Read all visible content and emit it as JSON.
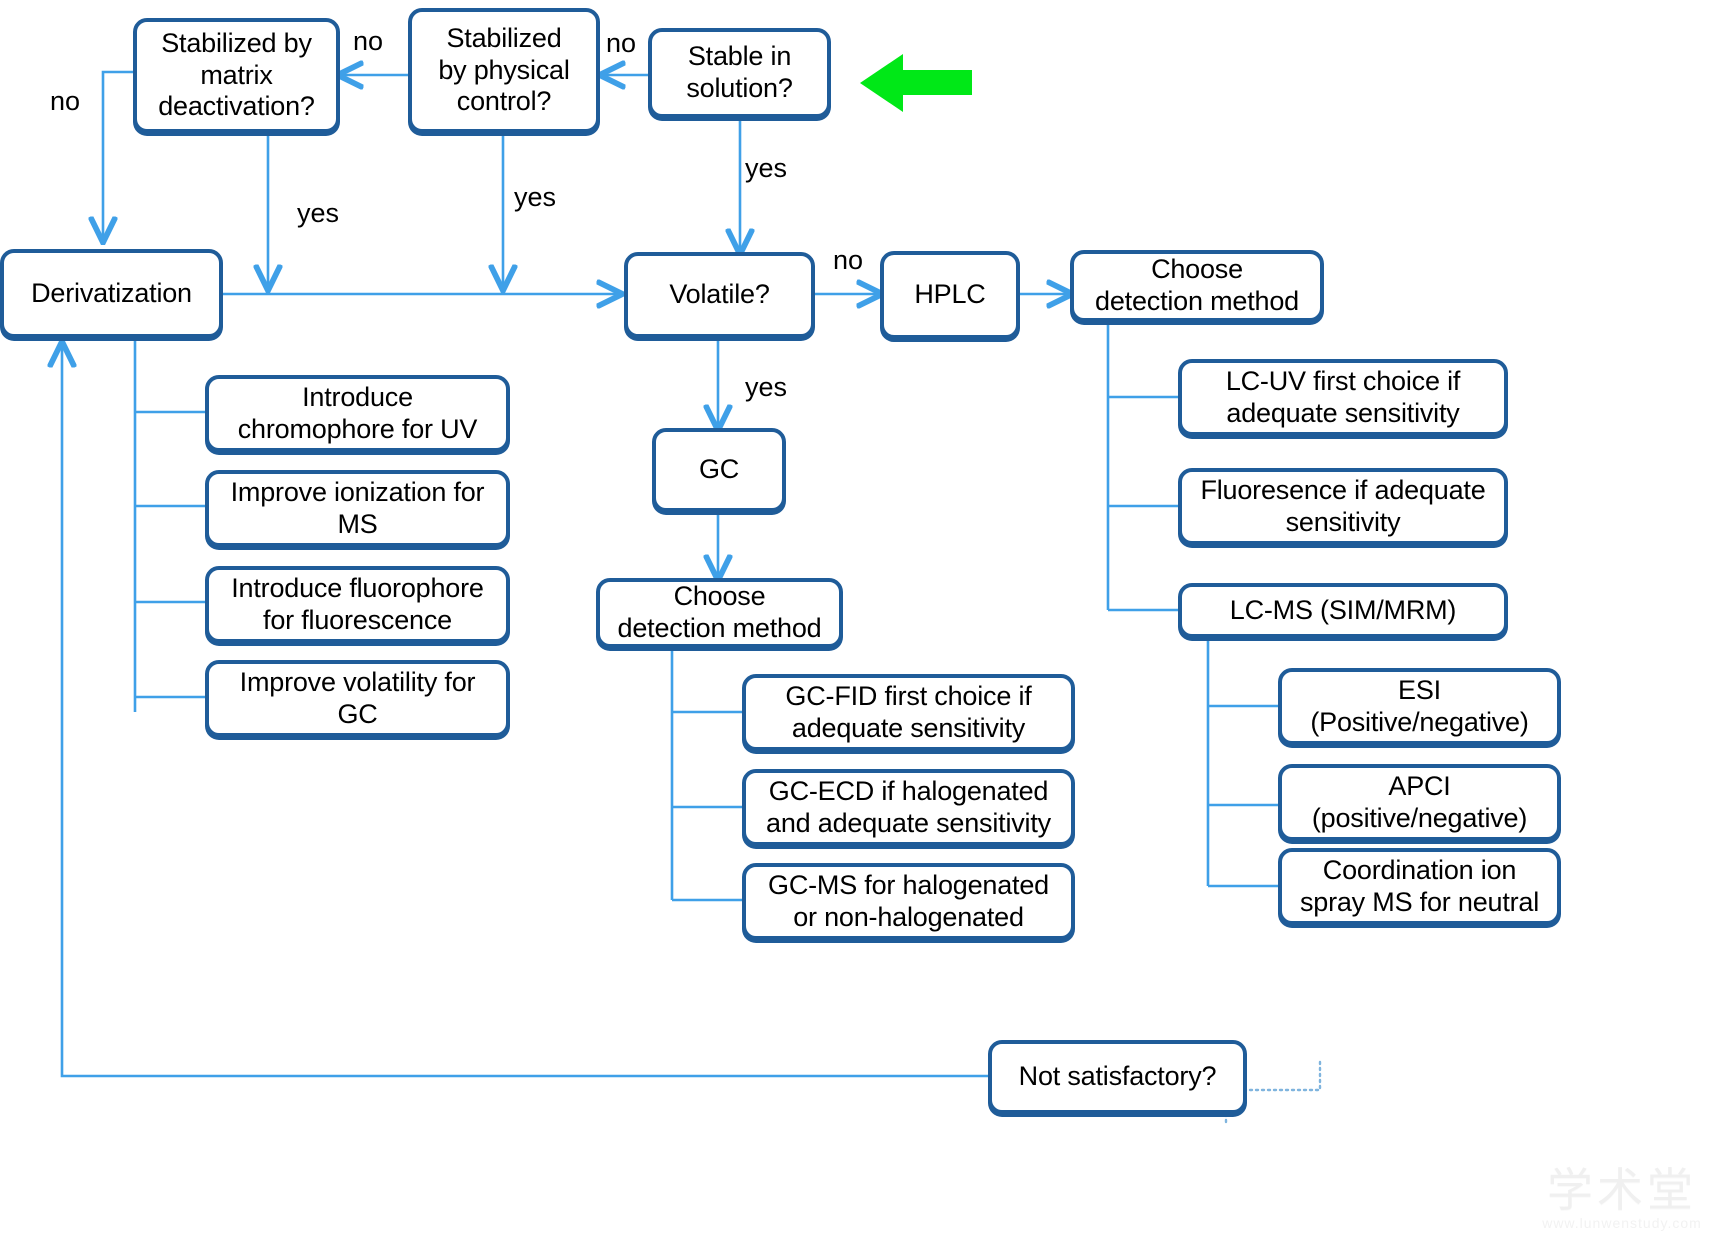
{
  "diagram": {
    "title": "Analytical method selection decision flowchart",
    "colors": {
      "node_border": "#1F5C99",
      "node_fill": "#FFFFFF",
      "connector": "#3FA0E8",
      "pointer_arrow": "#00E817",
      "text": "#000000"
    },
    "nodes": {
      "stabilized_matrix": "Stabilized by\nmatrix\ndeactivation?",
      "stabilized_matrix_lines": [
        "Stabilized by",
        "matrix",
        "deactivation?"
      ],
      "stabilized_physical_lines": [
        "Stabilized",
        "by physical",
        "control?"
      ],
      "stable_solution_lines": [
        "Stable in",
        "solution?"
      ],
      "derivatization_lines": [
        "Derivatization"
      ],
      "volatile_lines": [
        "Volatile?"
      ],
      "hplc_lines": [
        "HPLC"
      ],
      "gc_lines": [
        "GC"
      ],
      "choose_detection_lc_lines": [
        "Choose",
        "detection method"
      ],
      "choose_detection_gc_lines": [
        "Choose",
        "detection method"
      ],
      "not_satisfactory_lines": [
        "Not satisfactory?"
      ],
      "deriv_children": [
        [
          "Introduce",
          "chromophore for UV"
        ],
        [
          "Improve ionization for",
          "MS"
        ],
        [
          "Introduce fluorophore",
          "for  fluorescence"
        ],
        [
          "Improve volatility for",
          "GC"
        ]
      ],
      "gc_detection_children": [
        [
          "GC-FID first choice if",
          "adequate sensitivity"
        ],
        [
          "GC-ECD if halogenated",
          "and adequate  sensitivity"
        ],
        [
          "GC-MS for halogenated",
          "or non-halogenated"
        ]
      ],
      "lc_detection_children": [
        [
          "LC-UV first choice if",
          "adequate sensitivity"
        ],
        [
          "Fluoresence if adequate",
          "sensitivity"
        ],
        [
          "LC-MS (SIM/MRM)"
        ]
      ],
      "lcms_children": [
        [
          "ESI",
          "(Positive/negative)"
        ],
        [
          "APCI",
          "(positive/negative)"
        ],
        [
          "Coordination ion",
          "spray MS for neutral"
        ]
      ]
    },
    "edge_labels": {
      "no_left_outer": "no",
      "no_matrix": "no",
      "no_physical": "no",
      "yes_matrix": "yes",
      "yes_physical": "yes",
      "yes_stable": "yes",
      "no_volatile": "no",
      "yes_volatile": "yes"
    },
    "pointer": {
      "name": "green-left-arrow",
      "direction": "left"
    },
    "watermark": {
      "cn": "学术堂",
      "url": "www.lunwenstudy.com"
    }
  }
}
